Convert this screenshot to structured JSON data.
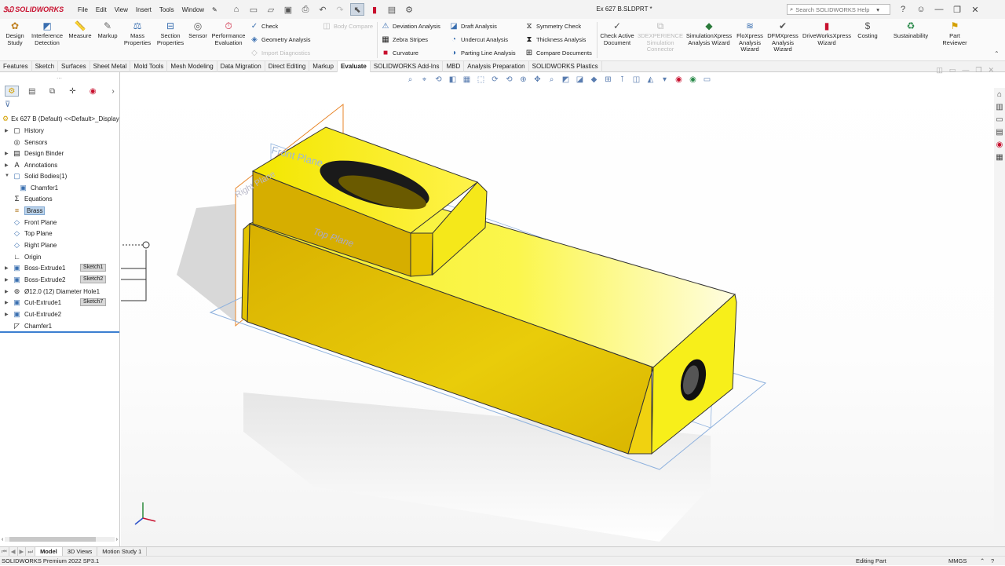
{
  "app": {
    "name": "SOLIDWORKS",
    "doc_title": "Ex 627 B.SLDPRT *"
  },
  "menu": [
    "File",
    "Edit",
    "View",
    "Insert",
    "Tools",
    "Window"
  ],
  "search": {
    "placeholder": "Search SOLIDWORKS Help"
  },
  "ribbon": {
    "design_study": "Design\nStudy",
    "interference": "Interference\nDetection",
    "measure": "Measure",
    "markup": "Markup",
    "mass_properties": "Mass\nProperties",
    "section_properties": "Section\nProperties",
    "sensor": "Sensor",
    "performance": "Performance\nEvaluation",
    "check": "Check",
    "geometry_analysis": "Geometry Analysis",
    "import_diagnostics": "Import Diagnostics",
    "body_compare": "Body Compare",
    "deviation_analysis": "Deviation Analysis",
    "zebra_stripes": "Zebra Stripes",
    "curvature": "Curvature",
    "draft_analysis": "Draft Analysis",
    "undercut_analysis": "Undercut Analysis",
    "parting_line_analysis": "Parting Line Analysis",
    "symmetry_check": "Symmetry Check",
    "thickness_analysis": "Thickness Analysis",
    "compare_documents": "Compare Documents",
    "check_active_document": "Check Active\nDocument",
    "experience_connector": "3DEXPERIENCE\nSimulation\nConnector",
    "simxpress": "SimulationXpress\nAnalysis Wizard",
    "floxpress": "FloXpress\nAnalysis\nWizard",
    "dfmxpress": "DFMXpress\nAnalysis\nWizard",
    "driveworks": "DriveWorksXpress\nWizard",
    "costing": "Costing",
    "sustainability": "Sustainability",
    "part_reviewer": "Part\nReviewer"
  },
  "tabs": [
    "Features",
    "Sketch",
    "Surfaces",
    "Sheet Metal",
    "Mold Tools",
    "Mesh Modeling",
    "Data Migration",
    "Direct Editing",
    "Markup",
    "Evaluate",
    "SOLIDWORKS Add-Ins",
    "MBD",
    "Analysis Preparation",
    "SOLIDWORKS Plastics"
  ],
  "active_tab": "Evaluate",
  "tree": {
    "root": "Ex 627 B (Default) <<Default>_Display",
    "items": [
      "History",
      "Sensors",
      "Design Binder",
      "Annotations",
      "Solid Bodies(1)",
      "Chamfer1",
      "Equations",
      "Brass",
      "Front Plane",
      "Top Plane",
      "Right Plane",
      "Origin",
      "Boss-Extrude1",
      "Boss-Extrude2",
      "Ø12.0 (12) Diameter Hole1",
      "Cut-Extrude1",
      "Cut-Extrude2",
      "Chamfer1"
    ],
    "sketches": [
      "Sketch1",
      "Sketch2",
      "Sketch7"
    ]
  },
  "viewport": {
    "plane_labels": [
      "Front Plane",
      "Top Plane",
      "Right Plane"
    ],
    "model_color": "#f2e600"
  },
  "bottom_tabs": [
    "Model",
    "3D Views",
    "Motion Study 1"
  ],
  "status": {
    "left": "SOLIDWORKS Premium 2022 SP3.1",
    "mode": "Editing Part",
    "units": "MMGS"
  }
}
